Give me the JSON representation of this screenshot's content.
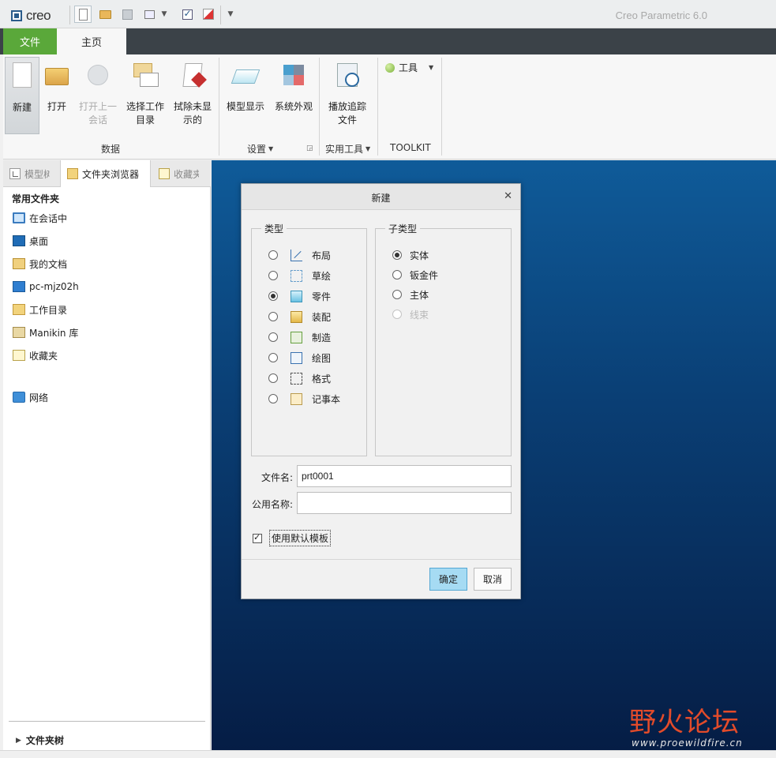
{
  "window": {
    "logo_text": "creo",
    "app_title": "Creo Parametric 6.0"
  },
  "quick_access": {
    "icons": [
      "new-icon",
      "open-icon",
      "save-icon",
      "window-icon",
      "regenerate-icon",
      "erase-icon",
      "caret-down-icon"
    ]
  },
  "menu": {
    "file_tab": "文件",
    "home_tab": "主页"
  },
  "ribbon": {
    "buttons": [
      {
        "label": "新建",
        "icon": "new-file-icon",
        "state": "selected"
      },
      {
        "label": "打开",
        "icon": "open-folder-icon",
        "state": "normal"
      },
      {
        "label": "打开上一会话",
        "icon": "open-last-session-icon",
        "state": "disabled"
      },
      {
        "label": "选择工作目录",
        "icon": "select-working-dir-icon",
        "state": "normal"
      },
      {
        "label": "拭除未显示的",
        "icon": "erase-not-displayed-icon",
        "state": "normal"
      },
      {
        "label": "模型显示",
        "icon": "model-display-icon",
        "state": "normal"
      },
      {
        "label": "系统外观",
        "icon": "system-appearance-icon",
        "state": "normal"
      },
      {
        "label": "播放追踪文件",
        "icon": "play-trail-icon",
        "state": "normal"
      }
    ],
    "btn_labels": {
      "new": "新建",
      "open": "打开",
      "open_last_1": "打开上一",
      "open_last_2": "会话",
      "workdir_1": "选择工作",
      "workdir_2": "目录",
      "erase_1": "拭除未显",
      "erase_2": "示的",
      "model_display": "模型显示",
      "sys_appearance": "系统外观",
      "trail_1": "播放追踪",
      "trail_2": "文件"
    },
    "tools_label": "工具",
    "groups": {
      "data": "数据",
      "settings": "设置",
      "utilities": "实用工具",
      "toolkit": "TOOLKIT"
    }
  },
  "panel_tabs": {
    "model_tree": "模型树",
    "folder_browser": "文件夹浏览器",
    "favorites": "收藏夹"
  },
  "left_panel": {
    "title": "常用文件夹",
    "items": [
      {
        "label": "在会话中",
        "icon": "session-monitor-icon"
      },
      {
        "label": "桌面",
        "icon": "desktop-icon"
      },
      {
        "label": "我的文档",
        "icon": "my-documents-icon"
      },
      {
        "label": "pc-mjz02h",
        "icon": "computer-icon"
      },
      {
        "label": "工作目录",
        "icon": "working-directory-icon"
      },
      {
        "label": "Manikin 库",
        "icon": "manikin-library-icon"
      },
      {
        "label": "收藏夹",
        "icon": "favorites-icon"
      }
    ],
    "network": "网络",
    "folder_tree": "文件夹树"
  },
  "dialog": {
    "title": "新建",
    "type_legend": "类型",
    "subtype_legend": "子类型",
    "types": [
      "布局",
      "草绘",
      "零件",
      "装配",
      "制造",
      "绘图",
      "格式",
      "记事本"
    ],
    "selected_type": "零件",
    "subtypes": [
      "实体",
      "钣金件",
      "主体",
      "线束"
    ],
    "selected_subtype": "实体",
    "disabled_subtype": "线束",
    "filename_label": "文件名:",
    "filename_value": "prt0001",
    "common_name_label": "公用名称:",
    "common_name_value": "",
    "use_default_template": "使用默认模板",
    "use_default_template_checked": true,
    "ok": "确定",
    "cancel": "取消"
  },
  "watermark": {
    "text_main": "野火论坛",
    "text_sub": "www.proewildfire.cn"
  },
  "colors": {
    "file_tab_green": "#5aa83a",
    "menubar_dark": "#3b4248",
    "graphics_top": "#0f5b99",
    "graphics_bottom": "#051d45",
    "ok_button": "#a6dbf3"
  }
}
